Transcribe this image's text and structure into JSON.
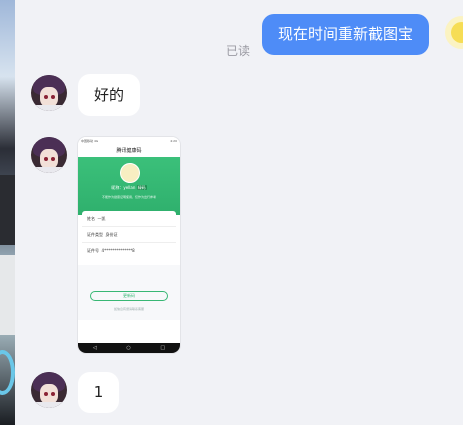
{
  "messages": {
    "outgoing_text": "现在时间重新截图宝",
    "read_status": "已读",
    "reply1": "好的",
    "reply2": "1"
  },
  "screenshot": {
    "status_left": "中国移动 4G",
    "status_right": "4:20",
    "title": "腾讯健康码",
    "user_name": "昵称：yellan",
    "user_tag": "绿码",
    "hero_note": "不能作为健康证明使用，仅作为出行参考",
    "name_label": "姓名",
    "name_value": "一凯",
    "id_type_label": "证件类型",
    "id_type_value": "身份证",
    "id_no_label": "证件号",
    "id_no_value": "4**************8",
    "button": "更新码",
    "footer_note": "如信息有误请联系客服"
  },
  "colors": {
    "bubble_blue": "#4e8cf7",
    "code_green": "#2fb06d"
  }
}
